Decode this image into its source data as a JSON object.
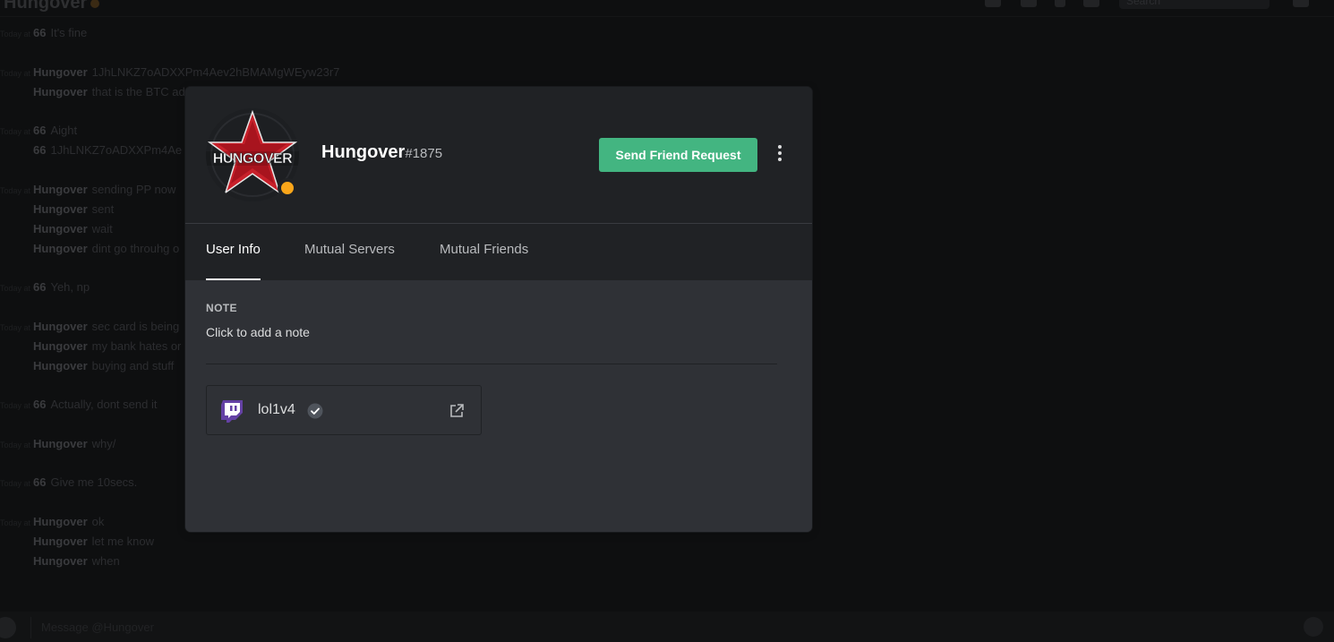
{
  "background": {
    "channel_title": "Hungover",
    "search_placeholder": "Search",
    "composer_placeholder": "Message @Hungover",
    "messages": [
      {
        "ts": "Today at",
        "author": "66",
        "text": "It's fine"
      },
      {
        "ts": "Today at",
        "author": "Hungover",
        "text": "1JhLNKZ7oADXXPm4Aev2hBMAMgWEyw23r7"
      },
      {
        "ts": "",
        "author": "Hungover",
        "text": "that is the BTC ad"
      },
      {
        "ts": "Today at",
        "author": "66",
        "text": "Aight"
      },
      {
        "ts": "",
        "author": "66",
        "text": "1JhLNKZ7oADXXPm4Ae"
      },
      {
        "ts": "Today at",
        "author": "Hungover",
        "text": "sending PP now"
      },
      {
        "ts": "",
        "author": "Hungover",
        "text": "sent"
      },
      {
        "ts": "",
        "author": "Hungover",
        "text": "wait"
      },
      {
        "ts": "",
        "author": "Hungover",
        "text": "dint go throuhg o"
      },
      {
        "ts": "Today at",
        "author": "66",
        "text": "Yeh, np"
      },
      {
        "ts": "Today at",
        "author": "Hungover",
        "text": "sec card is being"
      },
      {
        "ts": "",
        "author": "Hungover",
        "text": "my bank hates or"
      },
      {
        "ts": "",
        "author": "Hungover",
        "text": "buying  and stuff"
      },
      {
        "ts": "Today at",
        "author": "66",
        "text": "Actually, dont send it"
      },
      {
        "ts": "Today at",
        "author": "Hungover",
        "text": "why/"
      },
      {
        "ts": "Today at",
        "author": "66",
        "text": "Give me 10secs."
      },
      {
        "ts": "Today at",
        "author": "Hungover",
        "text": "ok"
      },
      {
        "ts": "",
        "author": "Hungover",
        "text": "let me know"
      },
      {
        "ts": "",
        "author": "Hungover",
        "text": "when"
      }
    ]
  },
  "profile": {
    "avatar_text": "HUNGOVER",
    "username": "Hungover",
    "discriminator": "#1875",
    "status_color": "#faa61a",
    "send_friend_request_label": "Send Friend Request",
    "more_icon": "more-vertical-icon"
  },
  "tabs": [
    {
      "label": "User Info",
      "active": true
    },
    {
      "label": "Mutual Servers",
      "active": false
    },
    {
      "label": "Mutual Friends",
      "active": false
    }
  ],
  "user_info": {
    "note_title": "NOTE",
    "note_placeholder": "Click to add a note",
    "connections": [
      {
        "platform": "twitch",
        "icon": "twitch-icon",
        "name": "lol1v4",
        "verified": true
      }
    ]
  },
  "colors": {
    "accent_green": "#43b581",
    "twitch_purple": "#6441a4",
    "status_idle": "#faa61a"
  }
}
